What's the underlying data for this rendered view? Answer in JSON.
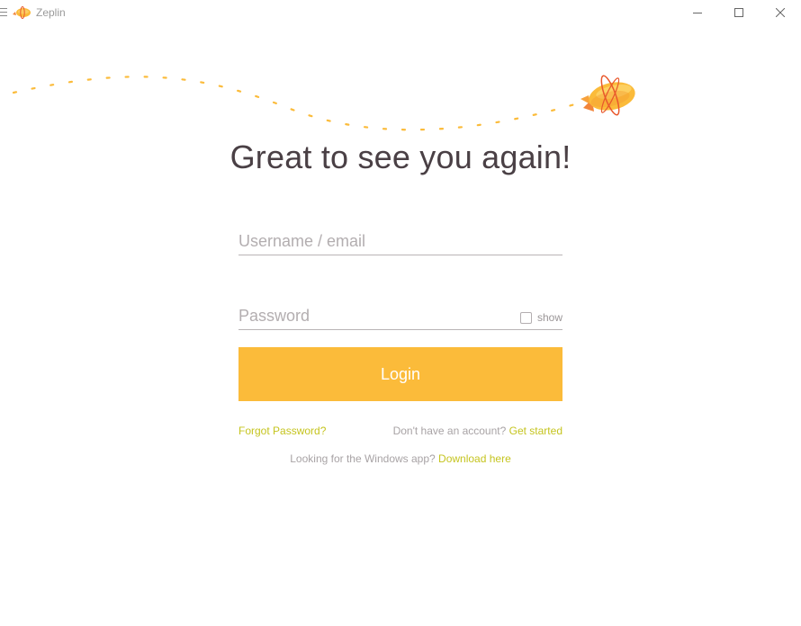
{
  "window": {
    "title": "Zeplin"
  },
  "colors": {
    "accent": "#fbbb3a",
    "link": "#c5c41f",
    "heading": "#4a4045",
    "muted": "#a8a3a5"
  },
  "icons": {
    "menu": "hamburger-menu-icon",
    "logo": "zeppelin-logo-icon",
    "minimize": "minimize-icon",
    "maximize": "maximize-icon",
    "close": "close-icon",
    "hero": "zeppelin-illustration"
  },
  "login": {
    "heading": "Great to see you again!",
    "username_placeholder": "Username / email",
    "username_value": "",
    "password_placeholder": "Password",
    "password_value": "",
    "show_label": "show",
    "show_checked": false,
    "button_label": "Login",
    "forgot_password": "Forgot Password?",
    "no_account_text": "Don't have an account?",
    "get_started": "Get started",
    "windows_app_text": "Looking for the Windows app?",
    "download_here": "Download here"
  }
}
